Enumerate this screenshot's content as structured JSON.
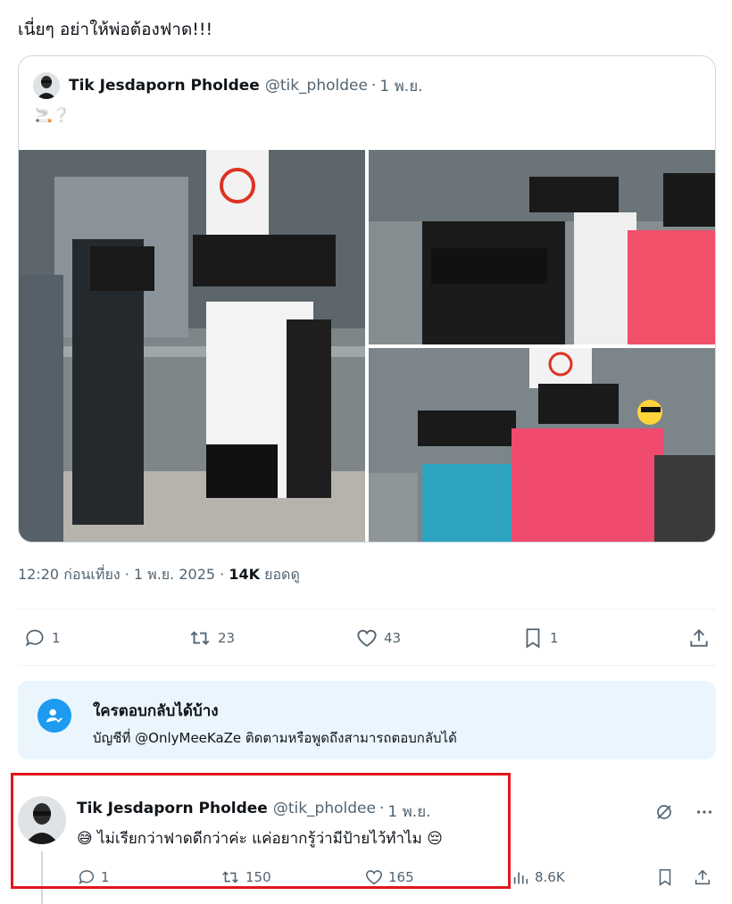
{
  "tweet": {
    "text": "เนี่ยๆ อย่าให้พ่อต้องฟาด!!!"
  },
  "quote": {
    "name": "Tik Jesdaporn Pholdee",
    "handle": "@tik_pholdee",
    "separator": "·",
    "time": "1 พ.ย.",
    "emoji": "🚬❔"
  },
  "meta": {
    "time_date": "12:20 ก่อนเที่ยง · 1 พ.ย. 2025 · ",
    "views": "14K",
    "views_label": " ยอดดู"
  },
  "actions": {
    "replies": "1",
    "reposts": "23",
    "likes": "43",
    "bookmarks": "1"
  },
  "reply_box": {
    "title": "ใครตอบกลับได้บ้าง",
    "desc": "บัญชีที่ @OnlyMeeKaZe ติดตามหรือพูดถึงสามารถตอบกลับได้"
  },
  "reply": {
    "name": "Tik Jesdaporn Pholdee",
    "handle": "@tik_pholdee",
    "separator": "·",
    "time": "1 พ.ย.",
    "text": "😅 ไม่เรียกว่าฟาดดีกว่าค่ะ แค่อยากรู้ว่ามีป้ายไว้ทำไม 😔",
    "replies": "1",
    "reposts": "150",
    "likes": "165",
    "views": "8.6K"
  },
  "colors": {
    "accent": "#1d9bf0",
    "highlight": "#e3161e",
    "muted": "#536471"
  }
}
